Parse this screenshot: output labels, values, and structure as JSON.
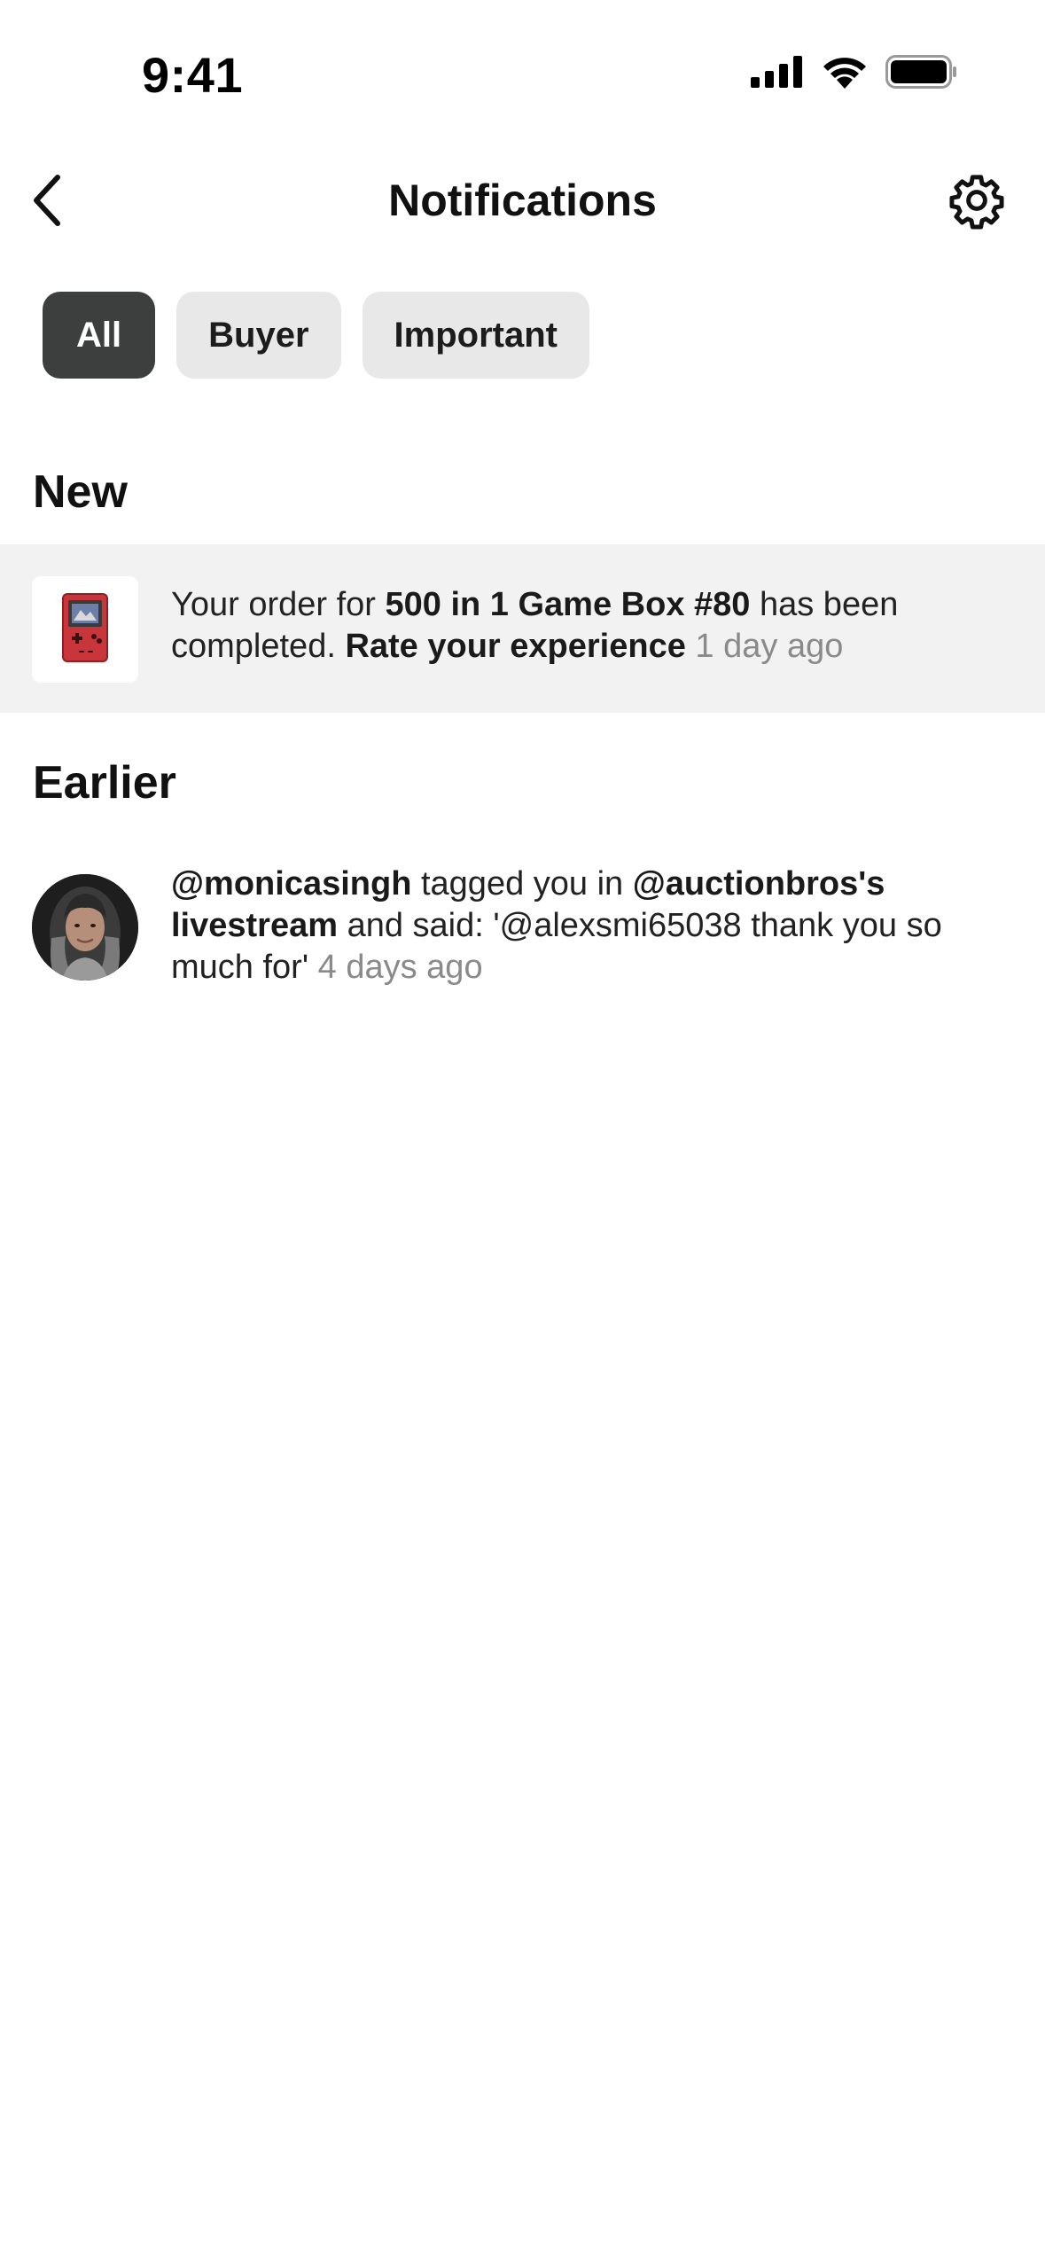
{
  "status_bar": {
    "time": "9:41",
    "icons": [
      "cellular-signal-icon",
      "wifi-icon",
      "battery-icon"
    ]
  },
  "header": {
    "title": "Notifications",
    "back_icon": "chevron-left-icon",
    "settings_icon": "gear-icon"
  },
  "filters": {
    "active": "All",
    "tabs": [
      {
        "label": "All"
      },
      {
        "label": "Buyer"
      },
      {
        "label": "Important"
      }
    ]
  },
  "sections": {
    "new": {
      "title": "New",
      "items": [
        {
          "thumbnail": "handheld-game-console-red",
          "text_1": "Your order for ",
          "bold_1": "500 in 1 Game Box #80",
          "text_2": " has been completed. ",
          "bold_2": "Rate your experience",
          "time": "1 day ago"
        }
      ]
    },
    "earlier": {
      "title": "Earlier",
      "items": [
        {
          "avatar": "user-avatar",
          "bold_1": "@monicasingh",
          "text_1": " tagged you in ",
          "bold_2": "@auctionbros's livestream",
          "text_2": " and said: '@alexsmi65038 thank you so much for'",
          "time": "4 days ago"
        }
      ]
    }
  },
  "colors": {
    "active_chip_bg": "#3d3f3f",
    "chip_bg": "#e8e8e8",
    "new_row_bg": "#f2f2f2",
    "timestamp": "#8a8a8a"
  }
}
